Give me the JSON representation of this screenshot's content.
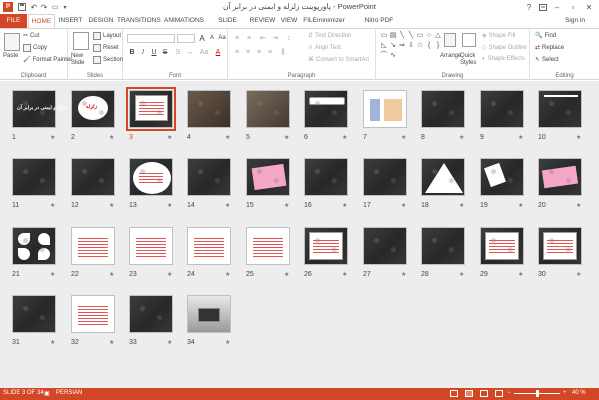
{
  "window": {
    "title": "پاورپوینت زلزله و ایمنی در برابر آن - PowerPoint",
    "sign_in": "Sign in",
    "help_glyph": "?"
  },
  "tabs": [
    "FILE",
    "HOME",
    "INSERT",
    "DESIGN",
    "TRANSITIONS",
    "ANIMATIONS",
    "SLIDE SHOW",
    "REVIEW",
    "VIEW",
    "FILEminimizer",
    "Nitro PDF Professional"
  ],
  "ribbon": {
    "clipboard": {
      "paste": "Paste",
      "cut": "Cut",
      "copy": "Copy",
      "format_painter": "Format Painter",
      "label": "Clipboard"
    },
    "slides": {
      "new_slide": "New Slide",
      "layout": "Layout",
      "reset": "Reset",
      "section": "Section",
      "label": "Slides"
    },
    "font": {
      "label": "Font",
      "bold": "B",
      "italic": "I",
      "underline": "U",
      "strike": "S",
      "grow": "A",
      "shrink": "A",
      "clear": "Aa"
    },
    "paragraph": {
      "text_direction": "Text Direction",
      "align_text": "Align Text",
      "convert_smartart": "Convert to SmartArt",
      "label": "Paragraph"
    },
    "drawing": {
      "arrange": "Arrange",
      "quick_styles": "Quick Styles",
      "shape_fill": "Shape Fill",
      "shape_outline": "Shape Outline",
      "shape_effects": "Shape Effects",
      "label": "Drawing"
    },
    "editing": {
      "find": "Find",
      "replace": "Replace",
      "select": "Select",
      "label": "Editing"
    }
  },
  "slides": [
    {
      "n": "1",
      "caption": "زلزله و ایمنی در برابر آن"
    },
    {
      "n": "2",
      "caption": "زلزله"
    },
    {
      "n": "3",
      "caption": ""
    },
    {
      "n": "4",
      "caption": ""
    },
    {
      "n": "5",
      "caption": ""
    },
    {
      "n": "6",
      "caption": ""
    },
    {
      "n": "7",
      "caption": ""
    },
    {
      "n": "8",
      "caption": ""
    },
    {
      "n": "9",
      "caption": ""
    },
    {
      "n": "10",
      "caption": ""
    },
    {
      "n": "11",
      "caption": ""
    },
    {
      "n": "12",
      "caption": ""
    },
    {
      "n": "13",
      "caption": ""
    },
    {
      "n": "14",
      "caption": ""
    },
    {
      "n": "15",
      "caption": ""
    },
    {
      "n": "16",
      "caption": ""
    },
    {
      "n": "17",
      "caption": ""
    },
    {
      "n": "18",
      "caption": ""
    },
    {
      "n": "19",
      "caption": ""
    },
    {
      "n": "20",
      "caption": ""
    },
    {
      "n": "21",
      "caption": ""
    },
    {
      "n": "22",
      "caption": ""
    },
    {
      "n": "23",
      "caption": ""
    },
    {
      "n": "24",
      "caption": ""
    },
    {
      "n": "25",
      "caption": ""
    },
    {
      "n": "26",
      "caption": ""
    },
    {
      "n": "27",
      "caption": ""
    },
    {
      "n": "28",
      "caption": ""
    },
    {
      "n": "29",
      "caption": ""
    },
    {
      "n": "30",
      "caption": ""
    },
    {
      "n": "31",
      "caption": ""
    },
    {
      "n": "32",
      "caption": ""
    },
    {
      "n": "33",
      "caption": ""
    },
    {
      "n": "34",
      "caption": ""
    }
  ],
  "selected_slide": "3",
  "star_glyph": "★",
  "status": {
    "slide_info": "SLIDE 3 OF 34",
    "language": "PERSIAN",
    "zoom": "40 %",
    "zoom_out": "−",
    "zoom_in": "+"
  },
  "colors": {
    "accent": "#d24726"
  }
}
